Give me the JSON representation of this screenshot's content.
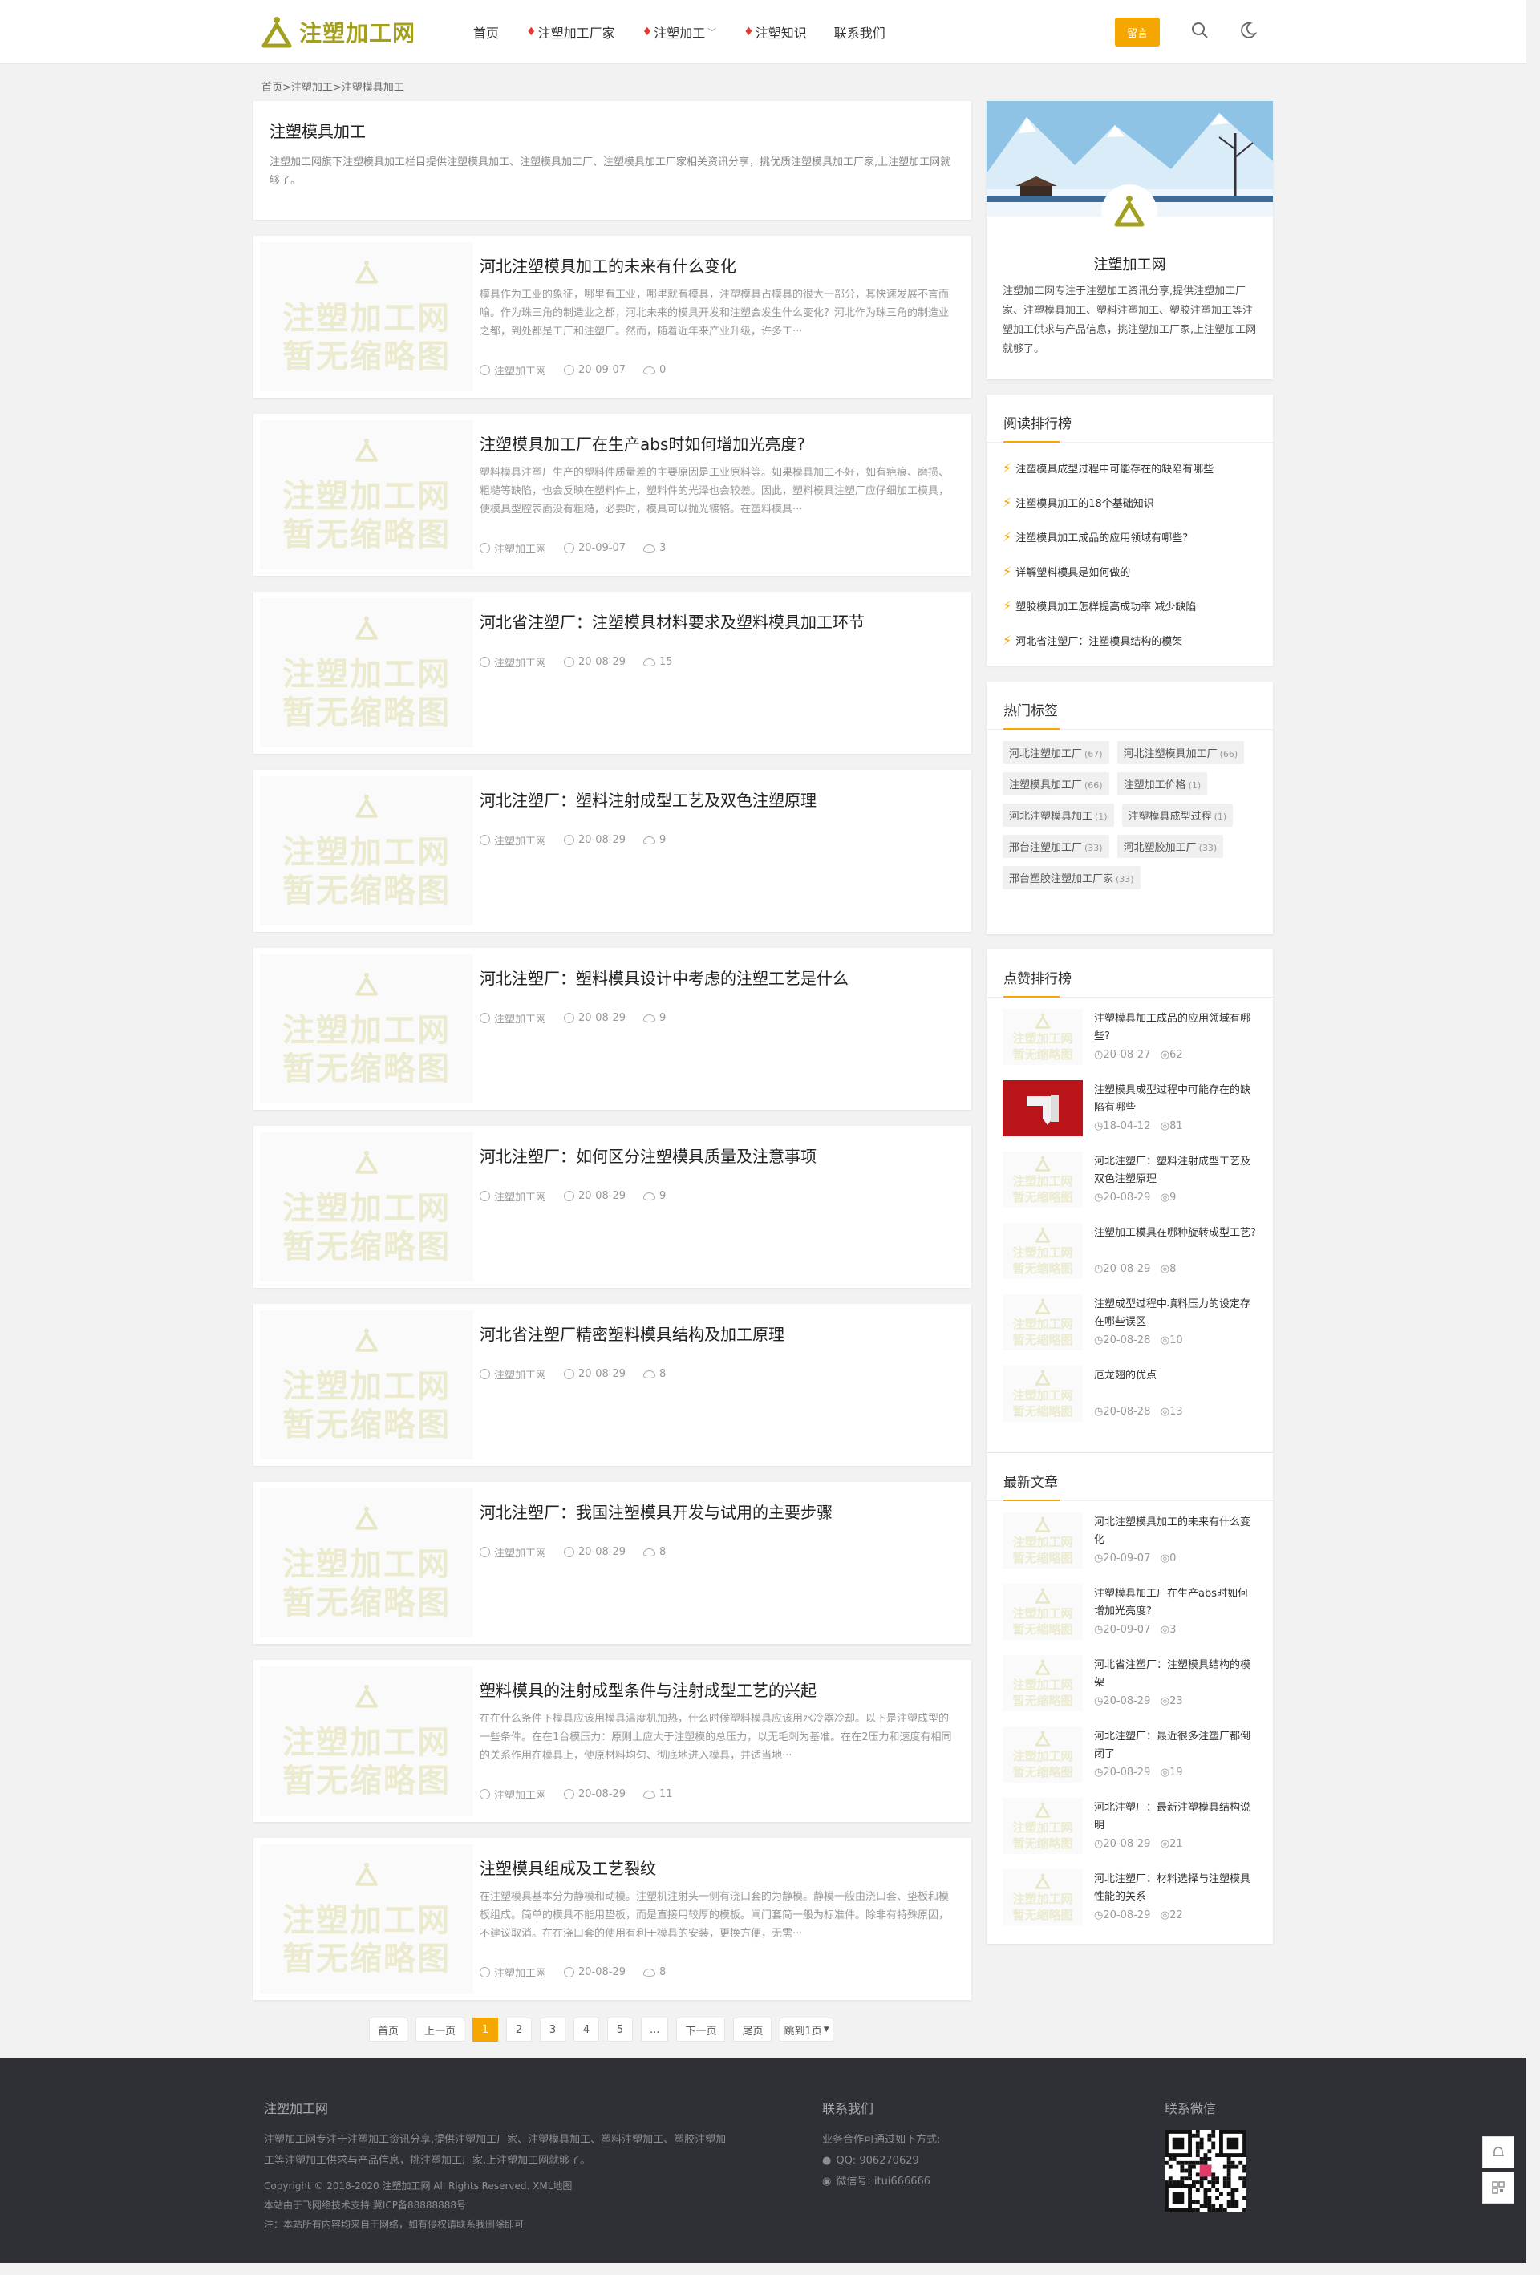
{
  "header": {
    "logo_text": "注塑加工网",
    "nav": [
      {
        "label": "首页",
        "hot": false,
        "dropdown": false
      },
      {
        "label": "注塑加工厂家",
        "hot": true,
        "dropdown": false
      },
      {
        "label": "注塑加工",
        "hot": true,
        "dropdown": true
      },
      {
        "label": "注塑知识",
        "hot": true,
        "dropdown": false
      },
      {
        "label": "联系我们",
        "hot": false,
        "dropdown": false
      }
    ],
    "message_button": "留言",
    "icons": [
      "search-icon",
      "moon-icon"
    ],
    "accent_color": "#f6a600"
  },
  "breadcrumb": "首页>注塑加工>注塑模具加工",
  "category": {
    "title": "注塑模具加工",
    "description": "注塑加工网旗下注塑模具加工栏目提供注塑模具加工、注塑模具加工厂、注塑模具加工厂家相关资讯分享，挑优质注塑模具加工厂家,上注塑加工网就够了。"
  },
  "placeholder": {
    "line1": "注塑加工网",
    "line2": "暂无缩略图"
  },
  "posts": [
    {
      "title": "河北注塑模具加工的未来有什么变化",
      "excerpt": "模具作为工业的象征，哪里有工业，哪里就有模具，注塑模具占模具的很大一部分，其快速发展不言而喻。作为珠三角的制造业之都，河北未来的模具开发和注塑会发生什么变化？河北作为珠三角的制造业之都，到处都是工厂和注塑厂。然而，随着近年来产业升级，许多工···",
      "author": "注塑加工网",
      "date": "20-09-07",
      "views": "0"
    },
    {
      "title": "注塑模具加工厂在生产abs时如何增加光亮度?",
      "excerpt": "塑料模具注塑厂生产的塑料件质量差的主要原因是工业原料等。如果模具加工不好，如有疤痕、磨损、粗糙等缺陷，也会反映在塑料件上，塑料件的光泽也会较差。因此，塑料模具注塑厂应仔细加工模具，使模具型腔表面没有粗糙，必要时，模具可以抛光镀铬。在塑料模具···",
      "author": "注塑加工网",
      "date": "20-09-07",
      "views": "3"
    },
    {
      "title": "河北省注塑厂：注塑模具材料要求及塑料模具加工环节",
      "excerpt": "",
      "author": "注塑加工网",
      "date": "20-08-29",
      "views": "15"
    },
    {
      "title": "河北注塑厂：塑料注射成型工艺及双色注塑原理",
      "excerpt": "",
      "author": "注塑加工网",
      "date": "20-08-29",
      "views": "9"
    },
    {
      "title": "河北注塑厂：塑料模具设计中考虑的注塑工艺是什么",
      "excerpt": "",
      "author": "注塑加工网",
      "date": "20-08-29",
      "views": "9"
    },
    {
      "title": "河北注塑厂：如何区分注塑模具质量及注意事项",
      "excerpt": "",
      "author": "注塑加工网",
      "date": "20-08-29",
      "views": "9"
    },
    {
      "title": "河北省注塑厂精密塑料模具结构及加工原理",
      "excerpt": "",
      "author": "注塑加工网",
      "date": "20-08-29",
      "views": "8"
    },
    {
      "title": "河北注塑厂：我国注塑模具开发与试用的主要步骤",
      "excerpt": "",
      "author": "注塑加工网",
      "date": "20-08-29",
      "views": "8"
    },
    {
      "title": "塑料模具的注射成型条件与注射成型工艺的兴起",
      "excerpt": "在在什么条件下模具应该用模具温度机加热，什么时候塑料模具应该用水冷器冷却。以下是注塑成型的一些条件。在在1台模压力：原则上应大于注塑模的总压力，以无毛刺为基准。在在2压力和速度有相同的关系作用在模具上，使原材料均匀、彻底地进入模具，并适当地···",
      "author": "注塑加工网",
      "date": "20-08-29",
      "views": "11"
    },
    {
      "title": "注塑模具组成及工艺裂纹",
      "excerpt": "在注塑模具基本分为静模和动模。注塑机注射头一侧有浇口套的为静模。静模一般由浇口套、垫板和模板组成。简单的模具不能用垫板，而是直接用较厚的模板。闸门套简一般为标准件。除非有特殊原因，不建议取消。在在浇口套的使用有利于模具的安装，更换方便，无需···",
      "author": "注塑加工网",
      "date": "20-08-29",
      "views": "8"
    }
  ],
  "pagination": {
    "first": "首页",
    "prev": "上一页",
    "pages": [
      "1",
      "2",
      "3",
      "4",
      "5",
      "..."
    ],
    "current": "1",
    "next": "下一页",
    "last": "尾页",
    "jump": "跳到1页"
  },
  "sidebar": {
    "profile": {
      "name": "注塑加工网",
      "description": "注塑加工网专注于注塑加工资讯分享,提供注塑加工厂家、注塑模具加工、塑料注塑加工、塑胶注塑加工等注塑加工供求与产品信息，挑注塑加工厂家,上注塑加工网就够了。"
    },
    "reading_rank": {
      "title": "阅读排行榜",
      "items": [
        "注塑模具成型过程中可能存在的缺陷有哪些",
        "注塑模具加工的18个基础知识",
        "注塑模具加工成品的应用领域有哪些?",
        "详解塑料模具是如何做的",
        "塑胶模具加工怎样提高成功率 减少缺陷",
        "河北省注塑厂：注塑模具结构的模架"
      ]
    },
    "hot_tags": {
      "title": "热门标签",
      "tags": [
        {
          "name": "河北注塑加工厂",
          "count": "(67)"
        },
        {
          "name": "河北注塑模具加工厂",
          "count": "(66)"
        },
        {
          "name": "注塑模具加工厂",
          "count": "(66)"
        },
        {
          "name": "注塑加工价格",
          "count": "(1)"
        },
        {
          "name": "河北注塑模具加工",
          "count": "(1)"
        },
        {
          "name": "注塑模具成型过程",
          "count": "(1)"
        },
        {
          "name": "邢台注塑加工厂",
          "count": "(33)"
        },
        {
          "name": "河北塑胶加工厂",
          "count": "(33)"
        },
        {
          "name": "邢台塑胶注塑加工厂家",
          "count": "(33)"
        }
      ]
    },
    "like_rank": {
      "title": "点赞排行榜",
      "items": [
        {
          "title": "注塑模具加工成品的应用领域有哪些?",
          "date": "20-08-27",
          "views": "62",
          "photo": false
        },
        {
          "title": "注塑模具成型过程中可能存在的缺陷有哪些",
          "date": "18-04-12",
          "views": "81",
          "photo": true
        },
        {
          "title": "河北注塑厂：塑料注射成型工艺及双色注塑原理",
          "date": "20-08-29",
          "views": "9",
          "photo": false
        },
        {
          "title": "注塑加工模具在哪种旋转成型工艺?",
          "date": "20-08-29",
          "views": "8",
          "photo": false
        },
        {
          "title": "注塑成型过程中填料压力的设定存在哪些误区",
          "date": "20-08-28",
          "views": "10",
          "photo": false
        },
        {
          "title": "厄龙翅的优点",
          "date": "20-08-28",
          "views": "13",
          "photo": false
        }
      ]
    },
    "latest": {
      "title": "最新文章",
      "items": [
        {
          "title": "河北注塑模具加工的未来有什么变化",
          "date": "20-09-07",
          "views": "0"
        },
        {
          "title": "注塑模具加工厂在生产abs时如何增加光亮度?",
          "date": "20-09-07",
          "views": "3"
        },
        {
          "title": "河北省注塑厂：注塑模具结构的模架",
          "date": "20-08-29",
          "views": "23"
        },
        {
          "title": "河北注塑厂：最近很多注塑厂都倒闭了",
          "date": "20-08-29",
          "views": "19"
        },
        {
          "title": "河北注塑厂：最新注塑模具结构说明",
          "date": "20-08-29",
          "views": "21"
        },
        {
          "title": "河北注塑厂：材料选择与注塑模具性能的关系",
          "date": "20-08-29",
          "views": "22"
        }
      ]
    }
  },
  "footer": {
    "about_title": "注塑加工网",
    "about_text": "注塑加工网专注于注塑加工资讯分享,提供注塑加工厂家、注塑模具加工、塑料注塑加工、塑胶注塑加工等注塑加工供求与产品信息，挑注塑加工厂家,上注塑加工网就够了。",
    "copyright": "Copyright © 2018-2020 注塑加工网 All Rights Reserved. XML地图",
    "tech": "本站由于飞网络技术支持    冀ICP备88888888号",
    "note": "注：本站所有内容均来自于网络，如有侵权请联系我删除即可",
    "contact_title": "联系我们",
    "contact_intro": "业务合作可通过如下方式:",
    "qq": "QQ:  906270629",
    "wechat": "微信号:  itui666666",
    "wechat_title": "联系微信"
  }
}
